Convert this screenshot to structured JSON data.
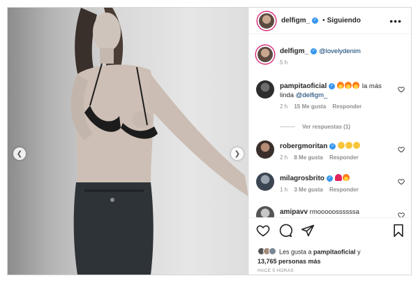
{
  "post": {
    "author": "delfigm_",
    "follow_separator": "•",
    "follow_label": "Siguiendo",
    "more_icon": "more-horizontal-icon"
  },
  "caption": {
    "user": "delfigm_",
    "text": "@lovelydenim",
    "time": "5 h"
  },
  "comments": [
    {
      "user": "pampitaoficial",
      "emojis": "fire fire fire",
      "text_line1": " la más",
      "text_line2": "linda ",
      "mention": "@delfigm_",
      "time": "2 h",
      "likes": "15 Me gusta",
      "reply": "Responder",
      "view_replies": "Ver respuestas (1)"
    },
    {
      "user": "robergmoritan",
      "emojis": "heart-eyes x3",
      "time": "2 h",
      "likes": "8 Me gusta",
      "reply": "Responder"
    },
    {
      "user": "milagrosbrito",
      "emojis": "heart fire",
      "time": "1 h",
      "likes": "3 Me gusta",
      "reply": "Responder"
    },
    {
      "user": "amipavv",
      "text": "rmooooossssssa"
    }
  ],
  "likes_summary": {
    "prefix": "Les gusta a ",
    "user": "pampitaoficial",
    "suffix": " y",
    "count": "13,765 personas más"
  },
  "timestamp": "HACE 5 HORAS",
  "colors": {
    "verified": "#3897f0",
    "link": "#00376b",
    "muted": "#8e8e8e",
    "story_ring": "#d62976"
  }
}
